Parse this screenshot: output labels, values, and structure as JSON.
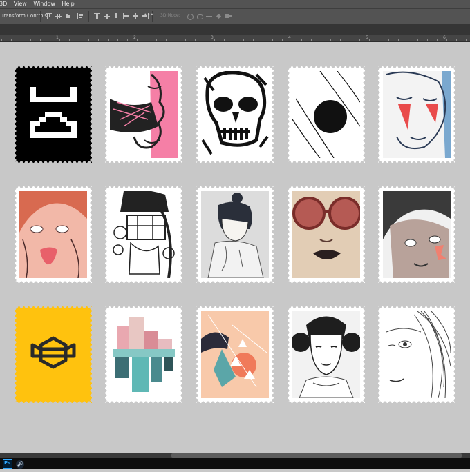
{
  "menubar": {
    "items": [
      "3D",
      "View",
      "Window",
      "Help"
    ]
  },
  "options_bar": {
    "transform_label": "Transform Controls",
    "more_label": "•••",
    "mode_3d_label": "3D Mode:",
    "icons": [
      "align-top-edges-icon",
      "align-vertical-centers-icon",
      "align-bottom-edges-icon",
      "align-left-edges-icon",
      "distribute-top-icon",
      "distribute-vcenter-icon",
      "distribute-bottom-icon",
      "distribute-left-icon",
      "distribute-hcenter-icon",
      "distribute-right-icon",
      "auto-align-layers-icon",
      "3d-orbit-icon",
      "3d-roll-icon",
      "3d-pan-icon",
      "3d-slide-icon",
      "3d-scale-icon"
    ]
  },
  "ruler": {
    "labels": [
      "1",
      "2",
      "3",
      "4",
      "5",
      "6"
    ]
  },
  "stamps": [
    {
      "name": "pixel-face",
      "background": "#000000"
    },
    {
      "name": "pink-face",
      "background": "#ffffff"
    },
    {
      "name": "skull",
      "background": "#ffffff"
    },
    {
      "name": "black-circle-lines",
      "background": "#ffffff"
    },
    {
      "name": "red-stripe-face",
      "background": "#f3f3f3"
    },
    {
      "name": "tongue-face",
      "background": "#f2b8a8"
    },
    {
      "name": "robot-helmet-girl",
      "background": "#ffffff"
    },
    {
      "name": "bun-hair-girl",
      "background": "#dcdcdc"
    },
    {
      "name": "round-sunglasses",
      "background": "#e2cdb5"
    },
    {
      "name": "curly-hair-face",
      "background": "#f0f0f0"
    },
    {
      "name": "bee-logo",
      "background": "#ffc20e"
    },
    {
      "name": "pastel-towers",
      "background": "#ffffff"
    },
    {
      "name": "geometric-portrait",
      "background": "#f8c9aa"
    },
    {
      "name": "leia-portrait",
      "background": "#f2f2f2"
    },
    {
      "name": "sketch-face",
      "background": "#ffffff"
    }
  ],
  "colors": {
    "canvas": "#c8c8c8",
    "toolbar": "#535353",
    "pink": "#f57fa6",
    "red": "#e94b4b",
    "yellow": "#ffc20e",
    "teal": "#5fb8b5"
  },
  "taskbar": {
    "items": [
      "photoshop-icon",
      "steam-icon"
    ],
    "ps_label": "Ps"
  }
}
